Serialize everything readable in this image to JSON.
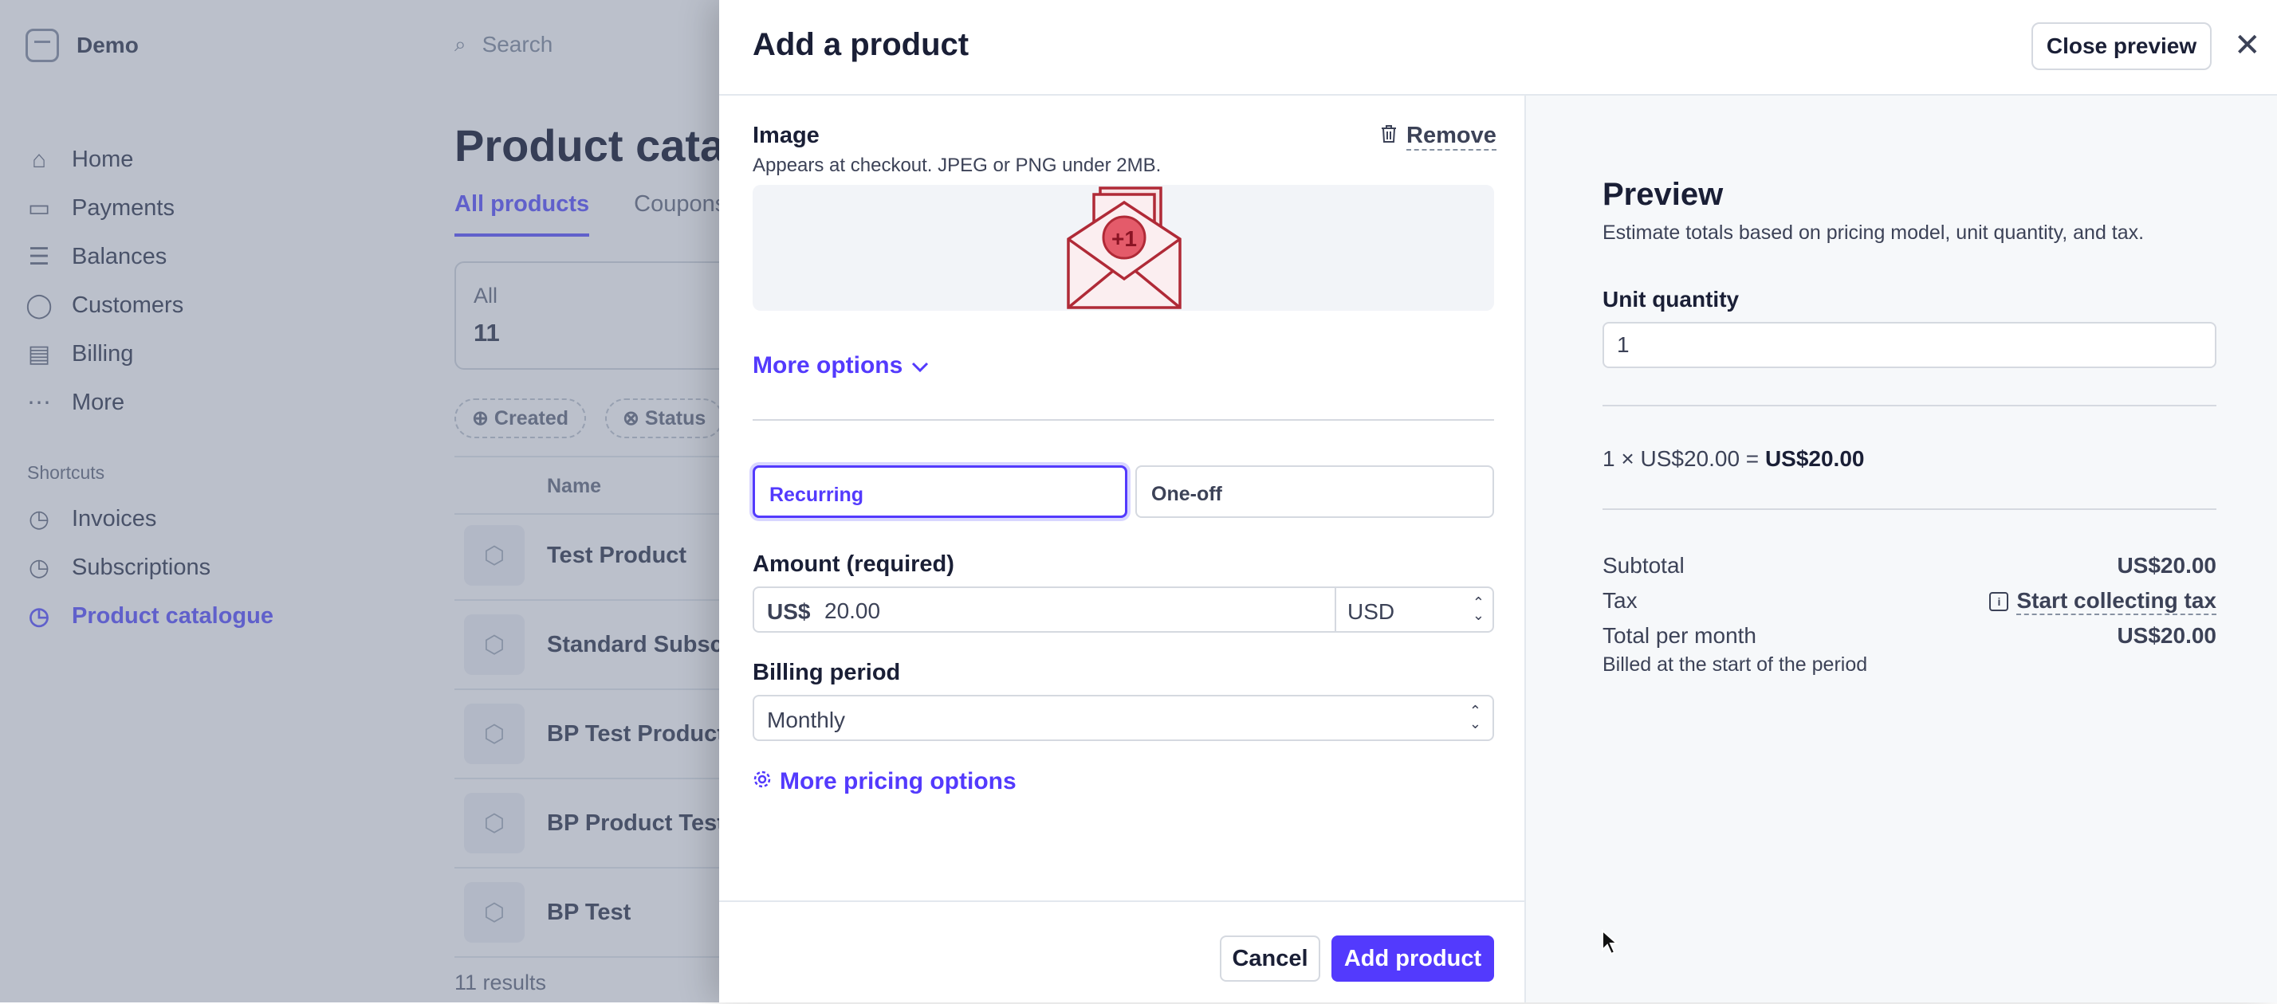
{
  "background": {
    "brand": "Demo",
    "search_placeholder": "Search",
    "nav": [
      {
        "label": "Home",
        "icon": "home-icon"
      },
      {
        "label": "Payments",
        "icon": "wallet-icon"
      },
      {
        "label": "Balances",
        "icon": "balances-icon"
      },
      {
        "label": "Customers",
        "icon": "user-icon"
      },
      {
        "label": "Billing",
        "icon": "billing-icon"
      },
      {
        "label": "More",
        "icon": "more-icon"
      }
    ],
    "shortcuts_label": "Shortcuts",
    "shortcuts": [
      {
        "label": "Invoices",
        "icon": "clock-icon"
      },
      {
        "label": "Subscriptions",
        "icon": "clock-icon"
      },
      {
        "label": "Product catalogue",
        "icon": "clock-icon"
      }
    ],
    "page_title": "Product cata",
    "tabs": [
      "All products",
      "Coupons"
    ],
    "stat": {
      "label": "All",
      "value": "11"
    },
    "filters": [
      "Created",
      "Status"
    ],
    "table": {
      "column": "Name",
      "rows": [
        "Test Product",
        "Standard Subsc",
        "BP Test Product",
        "BP Product Test",
        "BP Test"
      ]
    },
    "results": "11 results"
  },
  "modal": {
    "title": "Add a product",
    "close_preview": "Close preview",
    "close_icon": "close-icon",
    "image": {
      "label": "Image",
      "help": "Appears at checkout. JPEG or PNG under 2MB.",
      "remove": "Remove",
      "badge": "+1"
    },
    "more_options": "More options",
    "pricing": {
      "types": [
        "Recurring",
        "One-off"
      ],
      "selected": "Recurring",
      "amount_label": "Amount (required)",
      "currency_prefix": "US$",
      "amount_value": "20.00",
      "currency": "USD",
      "billing_label": "Billing period",
      "billing_value": "Monthly",
      "more_pricing": "More pricing options"
    },
    "footer": {
      "cancel": "Cancel",
      "add": "Add product"
    }
  },
  "preview": {
    "title": "Preview",
    "subtitle": "Estimate totals based on pricing model, unit quantity, and tax.",
    "unit_label": "Unit quantity",
    "unit_value": "1",
    "calc_prefix": "1 × US$20.00 = ",
    "calc_total": "US$20.00",
    "subtotal_label": "Subtotal",
    "subtotal_value": "US$20.00",
    "tax_label": "Tax",
    "tax_link": "Start collecting tax",
    "total_label": "Total per month",
    "total_value": "US$20.00",
    "billed_note": "Billed at the start of the period"
  },
  "colors": {
    "accent": "#533afd",
    "overlay": "#5e6a82"
  }
}
